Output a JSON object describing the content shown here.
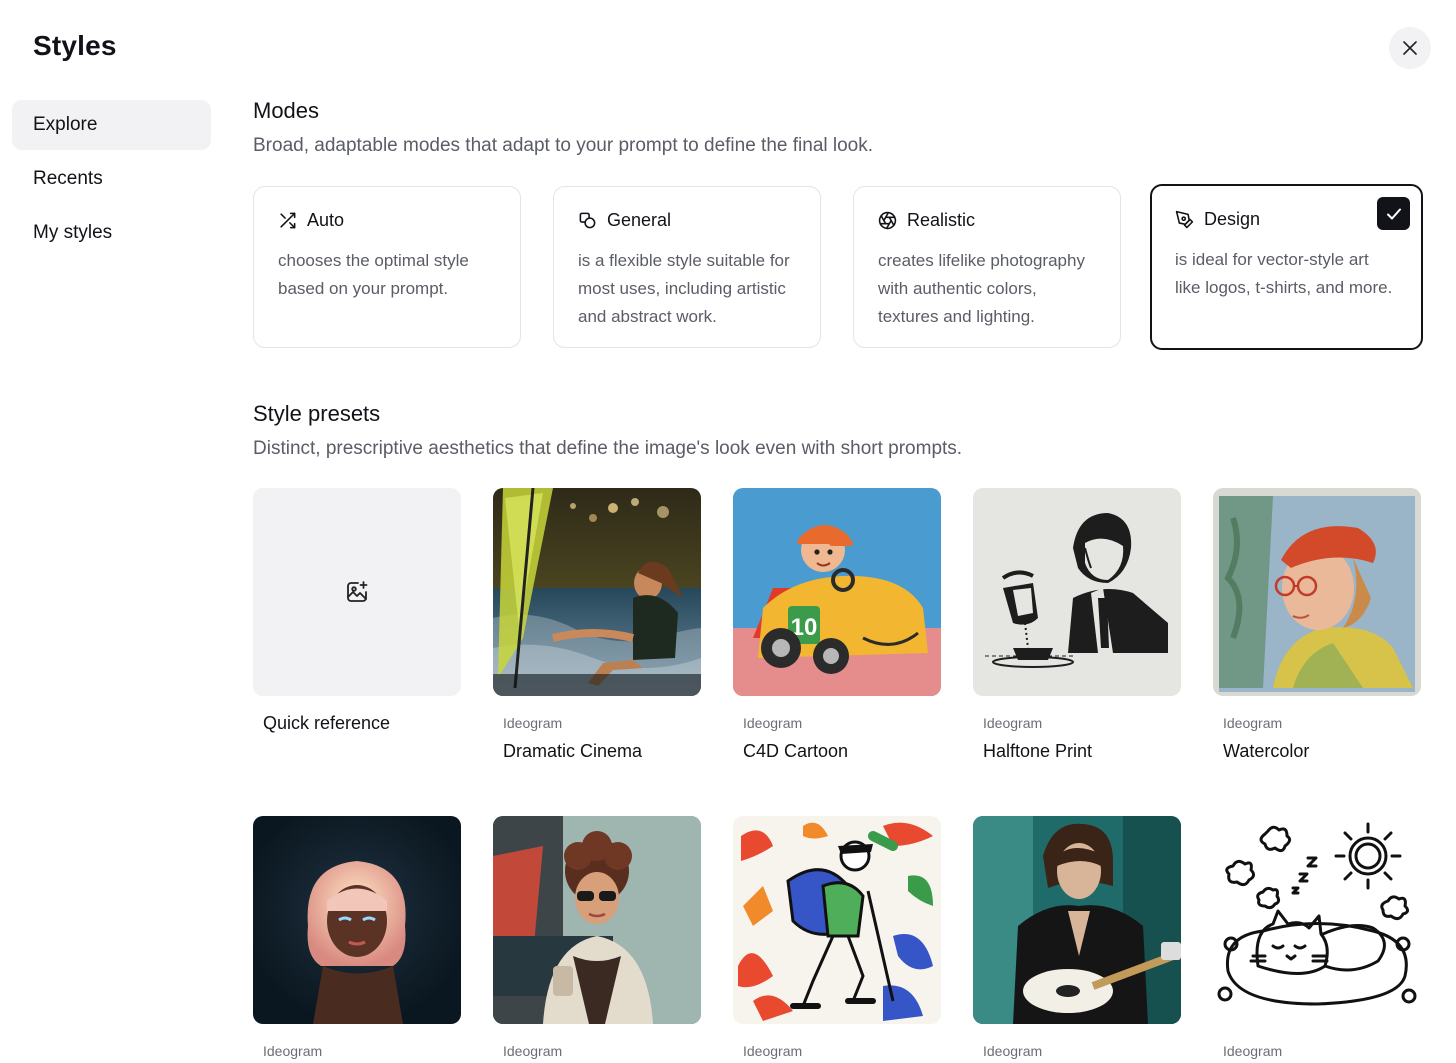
{
  "window": {
    "title": "Styles"
  },
  "sidebar": {
    "items": [
      {
        "label": "Explore",
        "active": true
      },
      {
        "label": "Recents",
        "active": false
      },
      {
        "label": "My styles",
        "active": false
      }
    ]
  },
  "modes": {
    "title": "Modes",
    "subtitle": "Broad, adaptable modes that adapt to your prompt to define the final look.",
    "cards": [
      {
        "name": "Auto",
        "icon": "shuffle-icon",
        "description": "chooses the optimal style based on your prompt.",
        "selected": false
      },
      {
        "name": "General",
        "icon": "shapes-icon",
        "description": "is a flexible style suitable for most uses, including artistic and abstract work.",
        "selected": false
      },
      {
        "name": "Realistic",
        "icon": "aperture-icon",
        "description": "creates lifelike photography with authentic colors, textures and lighting.",
        "selected": false
      },
      {
        "name": "Design",
        "icon": "pen-tool-icon",
        "description": "is ideal for vector-style art like logos, t-shirts, and more.",
        "selected": true
      }
    ]
  },
  "presets": {
    "title": "Style presets",
    "subtitle": "Distinct, prescriptive aesthetics that define the image's look even with short prompts.",
    "quick_reference": {
      "label": "Quick reference",
      "icon": "image-add-icon"
    },
    "row1": [
      {
        "tag": "Ideogram",
        "name": "Dramatic Cinema"
      },
      {
        "tag": "Ideogram",
        "name": "C4D Cartoon"
      },
      {
        "tag": "Ideogram",
        "name": "Halftone Print"
      },
      {
        "tag": "Ideogram",
        "name": "Watercolor"
      }
    ],
    "row2": [
      {
        "tag": "Ideogram"
      },
      {
        "tag": "Ideogram"
      },
      {
        "tag": "Ideogram"
      },
      {
        "tag": "Ideogram"
      },
      {
        "tag": "Ideogram"
      }
    ]
  },
  "colors": {
    "accent": "#111318",
    "muted_text": "#5a5d66",
    "card_border": "#e3e4e8",
    "surface": "#f2f2f4"
  }
}
